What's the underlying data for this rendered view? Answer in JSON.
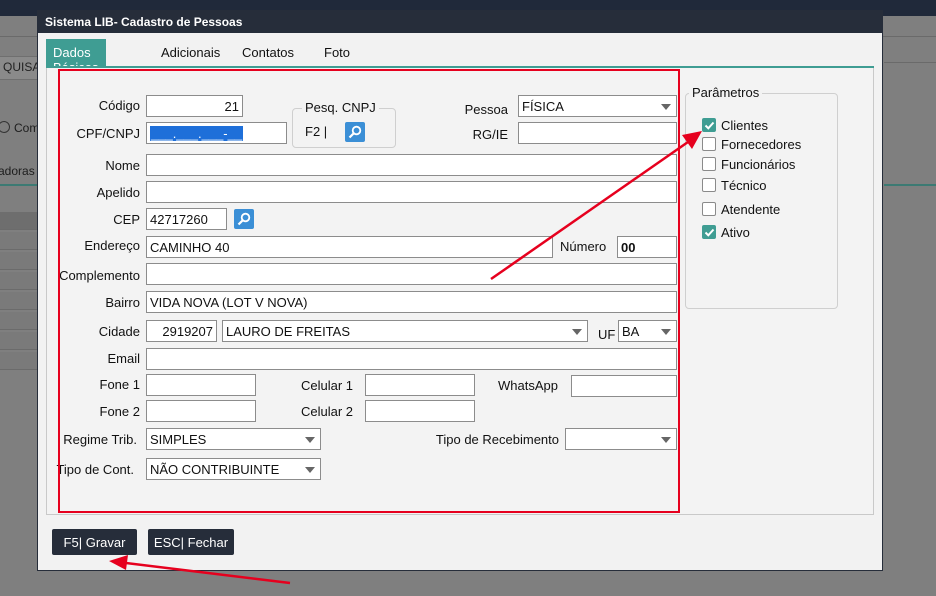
{
  "background": {
    "left_field_text": "QUISA",
    "radio_label": "Com",
    "section_text": "adoras"
  },
  "dialog": {
    "title": "Sistema LIB- Cadastro de Pessoas",
    "tabs": [
      {
        "label": "Dados Básicos",
        "active": true
      },
      {
        "label": "Adicionais",
        "active": false
      },
      {
        "label": "Contatos",
        "active": false
      },
      {
        "label": "Foto",
        "active": false
      }
    ]
  },
  "form": {
    "codigo": {
      "label": "Código",
      "value": "21"
    },
    "cpf_cnpj": {
      "label": "CPF/CNPJ",
      "value": "___.___.___-__"
    },
    "pesq_cnpj": {
      "legend": "Pesq. CNPJ",
      "shortcut": "F2 |"
    },
    "pessoa": {
      "label": "Pessoa",
      "value": "FÍSICA"
    },
    "rg_ie": {
      "label": "RG/IE",
      "value": ""
    },
    "nome": {
      "label": "Nome",
      "value": ""
    },
    "apelido": {
      "label": "Apelido",
      "value": ""
    },
    "cep": {
      "label": "CEP",
      "value": "42717260"
    },
    "endereco": {
      "label": "Endereço",
      "value": "CAMINHO 40"
    },
    "numero": {
      "label": "Número",
      "value": "00"
    },
    "complemento": {
      "label": "Complemento",
      "value": ""
    },
    "bairro": {
      "label": "Bairro",
      "value": "VIDA NOVA (LOT V NOVA)"
    },
    "cidade": {
      "label": "Cidade",
      "code": "2919207",
      "value": "LAURO DE FREITAS"
    },
    "uf": {
      "label": "UF",
      "value": "BA"
    },
    "email": {
      "label": "Email",
      "value": ""
    },
    "fone1": {
      "label": "Fone 1",
      "value": ""
    },
    "celular1": {
      "label": "Celular 1",
      "value": ""
    },
    "whatsapp": {
      "label": "WhatsApp",
      "value": ""
    },
    "fone2": {
      "label": "Fone 2",
      "value": ""
    },
    "celular2": {
      "label": "Celular 2",
      "value": ""
    },
    "regime_trib": {
      "label": "Regime Trib.",
      "value": "SIMPLES"
    },
    "tipo_recebimento": {
      "label": "Tipo de Recebimento",
      "value": ""
    },
    "tipo_cont": {
      "label": "Tipo de Cont.",
      "value": "NÃO CONTRIBUINTE"
    }
  },
  "parametros": {
    "legend": "Parâmetros",
    "items": [
      {
        "label": "Clientes",
        "checked": true
      },
      {
        "label": "Fornecedores",
        "checked": false
      },
      {
        "label": "Funcionários",
        "checked": false
      },
      {
        "label": "Técnico",
        "checked": false
      },
      {
        "label": "Atendente",
        "checked": false
      },
      {
        "label": "Ativo",
        "checked": true
      }
    ]
  },
  "buttons": {
    "gravar": "F5| Gravar",
    "fechar": "ESC| Fechar"
  },
  "colors": {
    "accent": "#3f9d93",
    "titlebar": "#262d3a",
    "annotation": "#e6001e"
  }
}
